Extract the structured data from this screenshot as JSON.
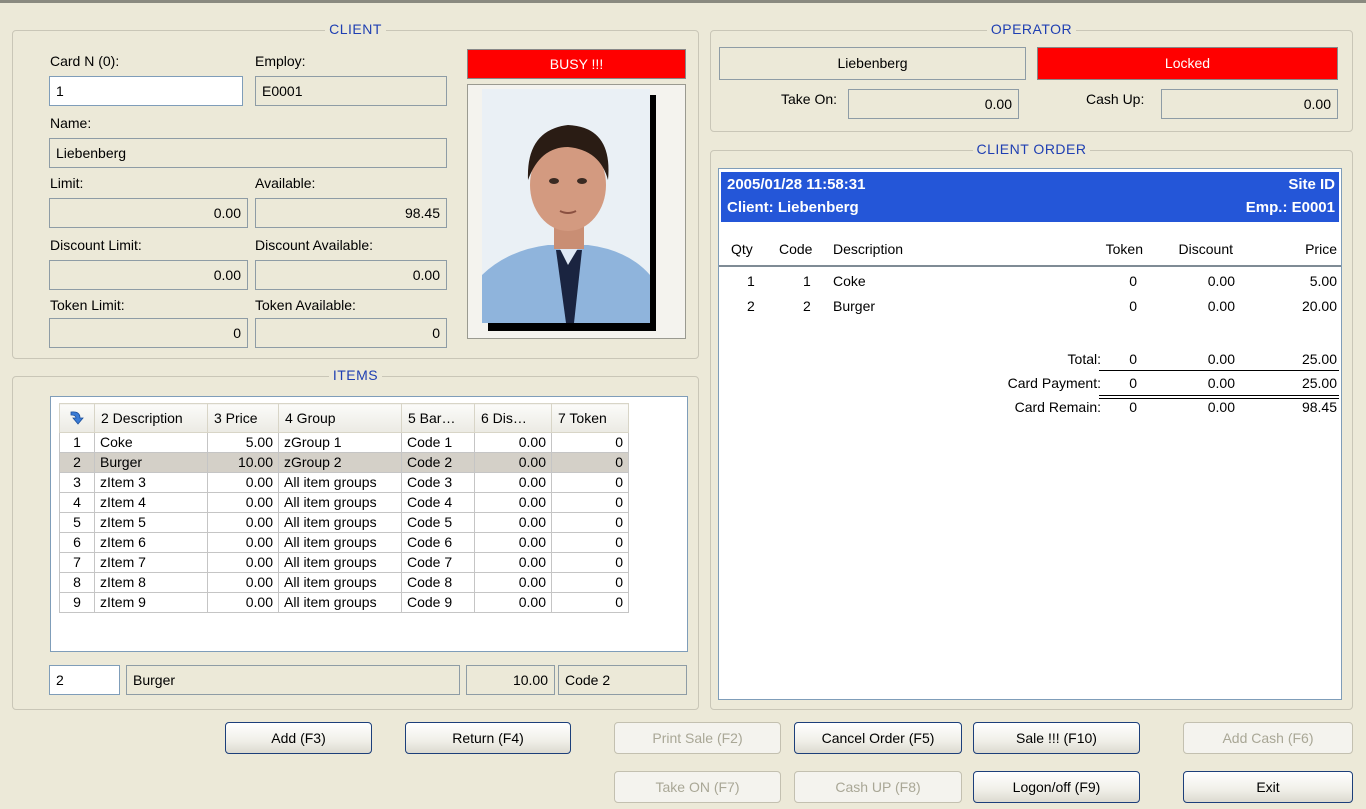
{
  "client": {
    "title": "CLIENT",
    "card_label": "Card N (0):",
    "card_value": "1",
    "employ_label": "Employ:",
    "employ_value": "E0001",
    "status": "BUSY !!!",
    "name_label": "Name:",
    "name_value": "Liebenberg",
    "limit_label": "Limit:",
    "limit_value": "0.00",
    "available_label": "Available:",
    "available_value": "98.45",
    "discount_limit_label": "Discount Limit:",
    "discount_limit_value": "0.00",
    "discount_available_label": "Discount Available:",
    "discount_available_value": "0.00",
    "token_limit_label": "Token Limit:",
    "token_limit_value": "0",
    "token_available_label": "Token Available:",
    "token_available_value": "0"
  },
  "operator": {
    "title": "OPERATOR",
    "name": "Liebenberg",
    "status": "Locked",
    "take_on_label": "Take On:",
    "take_on_value": "0.00",
    "cash_up_label": "Cash Up:",
    "cash_up_value": "0.00"
  },
  "items": {
    "title": "ITEMS",
    "columns": [
      "2 Description",
      "3 Price",
      "4 Group",
      "5 Bar…",
      "6 Dis…",
      "7 Token"
    ],
    "rows": [
      {
        "n": "1",
        "desc": "Coke",
        "price": "5.00",
        "group": "zGroup 1",
        "bar": "Code 1",
        "dis": "0.00",
        "token": "0"
      },
      {
        "n": "2",
        "desc": "Burger",
        "price": "10.00",
        "group": "zGroup 2",
        "bar": "Code 2",
        "dis": "0.00",
        "token": "0"
      },
      {
        "n": "3",
        "desc": "zItem 3",
        "price": "0.00",
        "group": "All item groups",
        "bar": "Code 3",
        "dis": "0.00",
        "token": "0"
      },
      {
        "n": "4",
        "desc": "zItem 4",
        "price": "0.00",
        "group": "All item groups",
        "bar": "Code 4",
        "dis": "0.00",
        "token": "0"
      },
      {
        "n": "5",
        "desc": "zItem 5",
        "price": "0.00",
        "group": "All item groups",
        "bar": "Code 5",
        "dis": "0.00",
        "token": "0"
      },
      {
        "n": "6",
        "desc": "zItem 6",
        "price": "0.00",
        "group": "All item groups",
        "bar": "Code 6",
        "dis": "0.00",
        "token": "0"
      },
      {
        "n": "7",
        "desc": "zItem 7",
        "price": "0.00",
        "group": "All item groups",
        "bar": "Code 7",
        "dis": "0.00",
        "token": "0"
      },
      {
        "n": "8",
        "desc": "zItem 8",
        "price": "0.00",
        "group": "All item groups",
        "bar": "Code 8",
        "dis": "0.00",
        "token": "0"
      },
      {
        "n": "9",
        "desc": "zItem 9",
        "price": "0.00",
        "group": "All item groups",
        "bar": "Code 9",
        "dis": "0.00",
        "token": "0"
      }
    ],
    "selected": {
      "qty": "2",
      "desc": "Burger",
      "price": "10.00",
      "code": "Code 2"
    }
  },
  "order": {
    "title": "CLIENT ORDER",
    "datetime": "2005/01/28 11:58:31",
    "site": "Site ID",
    "client": "Client: Liebenberg",
    "emp": "Emp.: E0001",
    "headers": {
      "qty": "Qty",
      "code": "Code",
      "desc": "Description",
      "token": "Token",
      "discount": "Discount",
      "price": "Price"
    },
    "lines": [
      {
        "qty": "1",
        "code": "1",
        "desc": "Coke",
        "token": "0",
        "discount": "0.00",
        "price": "5.00"
      },
      {
        "qty": "2",
        "code": "2",
        "desc": "Burger",
        "token": "0",
        "discount": "0.00",
        "price": "20.00"
      }
    ],
    "total": {
      "label": "Total:",
      "token": "0",
      "discount": "0.00",
      "price": "25.00"
    },
    "payment": {
      "label": "Card Payment:",
      "token": "0",
      "discount": "0.00",
      "price": "25.00"
    },
    "remain": {
      "label": "Card Remain:",
      "token": "0",
      "discount": "0.00",
      "price": "98.45"
    }
  },
  "buttons": {
    "add": "Add (F3)",
    "return": "Return (F4)",
    "print": "Print Sale (F2)",
    "cancel": "Cancel Order (F5)",
    "sale": "Sale !!! (F10)",
    "add_cash": "Add Cash (F6)",
    "take_on": "Take ON (F7)",
    "cash_up": "Cash UP (F8)",
    "logon": "Logon/off (F9)",
    "exit": "Exit"
  },
  "colors": {
    "status_red": "#ff0000",
    "order_header": "#2456d8",
    "group_title": "#1f3fb2"
  }
}
